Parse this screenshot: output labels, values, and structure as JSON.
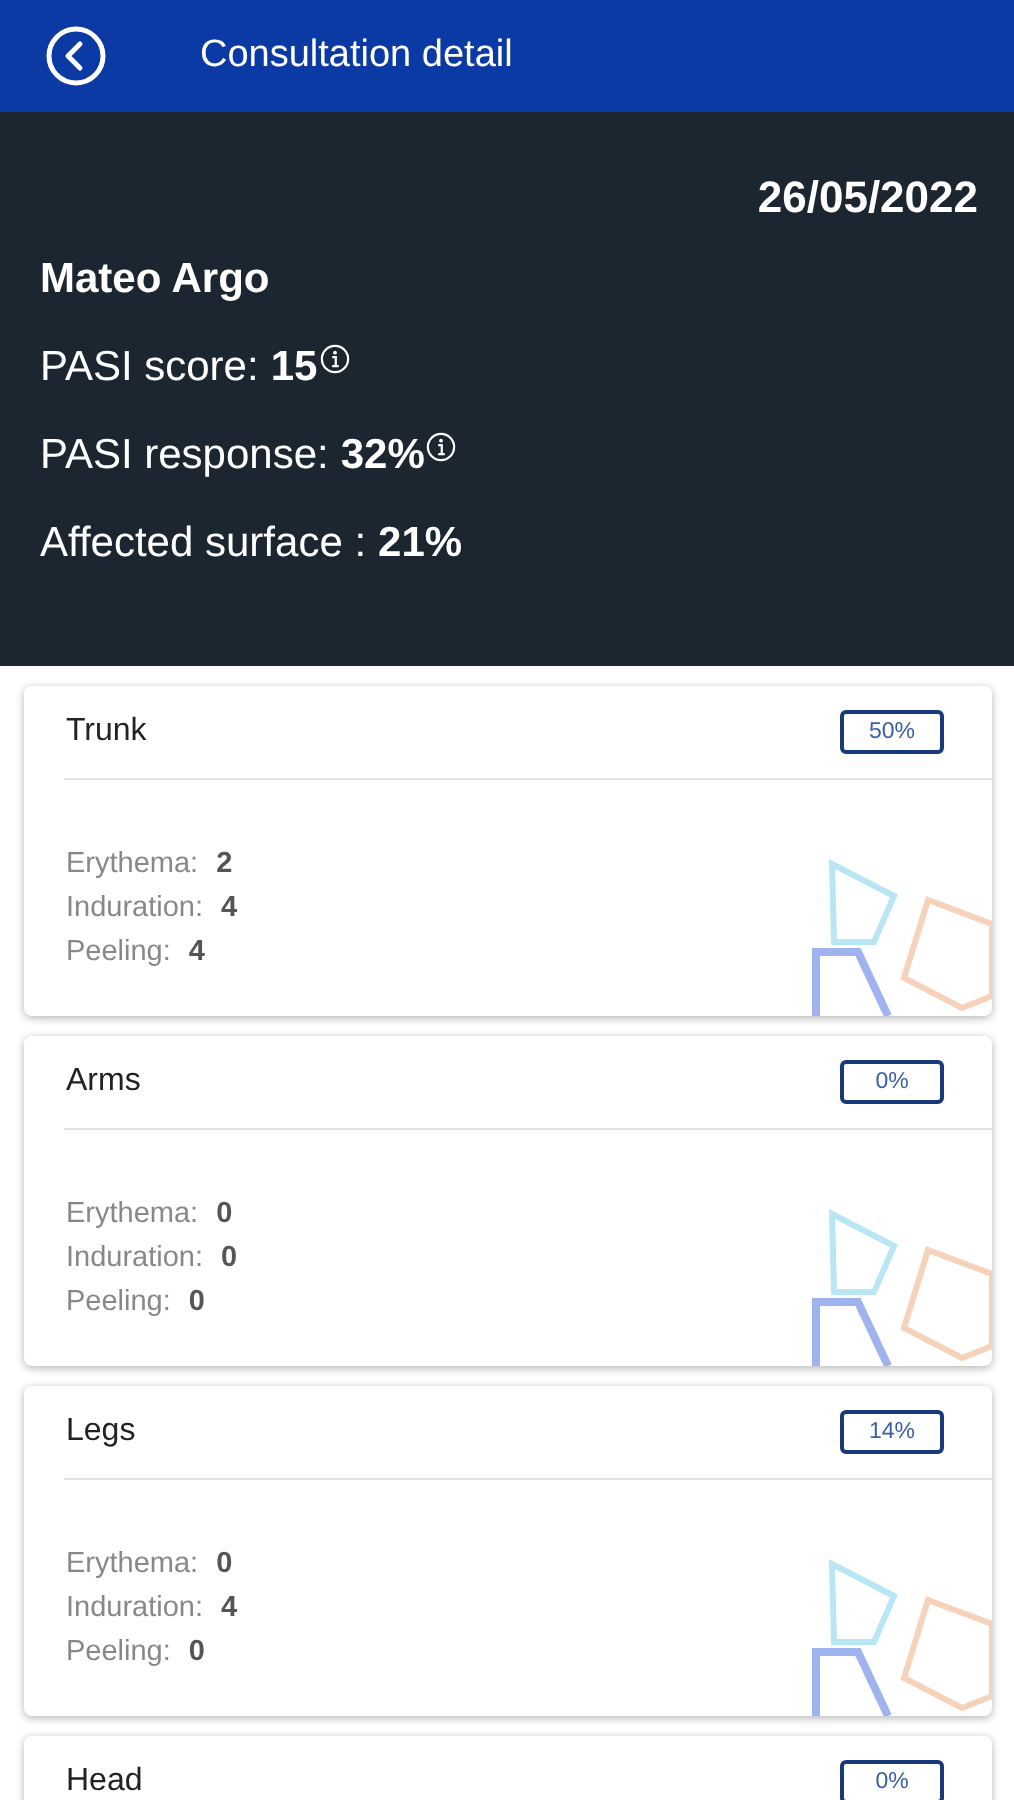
{
  "app_bar": {
    "title": "Consultation detail"
  },
  "summary": {
    "date": "26/05/2022",
    "patient": "Mateo Argo",
    "lines": [
      {
        "label": "PASI score:",
        "value": "15",
        "info": true
      },
      {
        "label": "PASI response:",
        "value": "32%",
        "info": true
      },
      {
        "label": "Affected surface :",
        "value": "21%",
        "info": false
      }
    ]
  },
  "regions": [
    {
      "name": "Trunk",
      "badge": "50%",
      "metrics": [
        {
          "label": "Erythema:",
          "value": "2"
        },
        {
          "label": "Induration:",
          "value": "4"
        },
        {
          "label": "Peeling:",
          "value": "4"
        }
      ]
    },
    {
      "name": "Arms",
      "badge": "0%",
      "metrics": [
        {
          "label": "Erythema:",
          "value": "0"
        },
        {
          "label": "Induration:",
          "value": "0"
        },
        {
          "label": "Peeling:",
          "value": "0"
        }
      ]
    },
    {
      "name": "Legs",
      "badge": "14%",
      "metrics": [
        {
          "label": "Erythema:",
          "value": "0"
        },
        {
          "label": "Induration:",
          "value": "4"
        },
        {
          "label": "Peeling:",
          "value": "0"
        }
      ]
    },
    {
      "name": "Head",
      "badge": "0%"
    }
  ]
}
